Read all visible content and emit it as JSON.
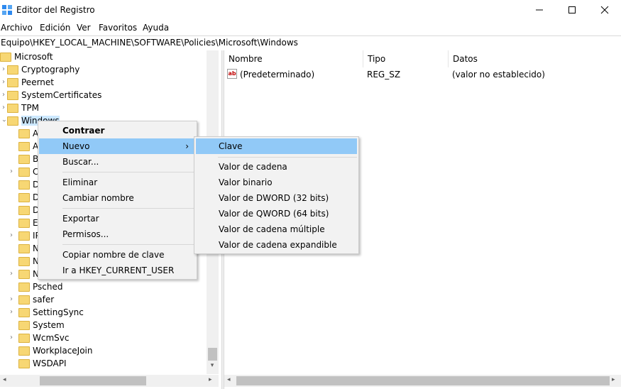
{
  "window": {
    "title": "Editor del Registro",
    "minimize_icon": "minimize-icon",
    "maximize_icon": "maximize-icon",
    "close_icon": "close-icon"
  },
  "menubar": [
    "Archivo",
    "Edición",
    "Ver",
    "Favoritos",
    "Ayuda"
  ],
  "address": "Equipo\\HKEY_LOCAL_MACHINE\\SOFTWARE\\Policies\\Microsoft\\Windows",
  "tree": {
    "top": [
      "Microsoft",
      "Cryptography",
      "Peernet",
      "SystemCertificates",
      "TPM",
      "Windows"
    ],
    "children_partial": [
      "A",
      "A",
      "B",
      "C",
      "D",
      "D",
      "D",
      "E",
      "IP",
      "N",
      "N",
      "N"
    ],
    "children": [
      "Psched",
      "safer",
      "SettingSync",
      "System",
      "WcmSvc",
      "WorkplaceJoin",
      "WSDAPI"
    ]
  },
  "list": {
    "columns": [
      "Nombre",
      "Tipo",
      "Datos"
    ],
    "rows": [
      {
        "name": "(Predeterminado)",
        "type": "REG_SZ",
        "data": "(valor no establecido)"
      }
    ]
  },
  "context_menu": {
    "collapse": "Contraer",
    "new": "Nuevo",
    "find": "Buscar...",
    "delete": "Eliminar",
    "rename": "Cambiar nombre",
    "export": "Exportar",
    "permissions": "Permisos...",
    "copy_key_name": "Copiar nombre de clave",
    "goto_hkcu": "Ir a HKEY_CURRENT_USER",
    "submenu_arrow": "›"
  },
  "submenu": {
    "key": "Clave",
    "items": [
      "Valor de cadena",
      "Valor binario",
      "Valor de DWORD (32 bits)",
      "Valor de QWORD (64 bits)",
      "Valor de cadena múltiple",
      "Valor de cadena expandible"
    ]
  },
  "colors": {
    "highlight": "#91c9f7",
    "selection": "#cce8ff",
    "folder": "#f7d774",
    "menu_bg": "#f2f2f2"
  }
}
